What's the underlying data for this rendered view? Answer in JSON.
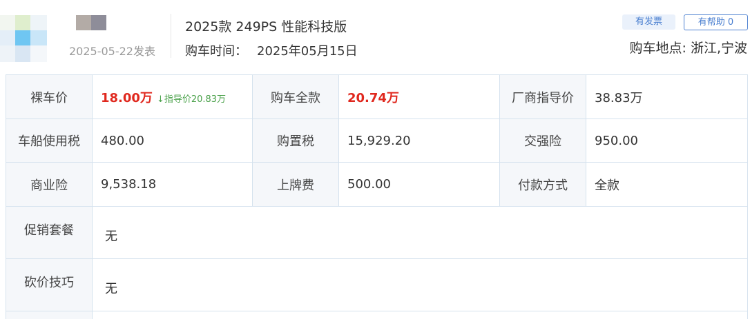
{
  "header": {
    "post_date": "2025-05-22发表",
    "car_model": "2025款 249PS 性能科技版",
    "purchase_time_label": "购车时间：",
    "purchase_time_value": "2025年05月15日",
    "invoice_tag": "有发票",
    "help_button": "有帮助 0",
    "location": "购车地点: 浙江,宁波"
  },
  "table": {
    "naked_price_label": "裸车价",
    "naked_price_value": "18.00万",
    "naked_price_note": "↓指导价20.83万",
    "total_price_label": "购车全款",
    "total_price_value": "20.74万",
    "msrp_label": "厂商指导价",
    "msrp_value": "38.83万",
    "vehicle_tax_label": "车船使用税",
    "vehicle_tax_value": "480.00",
    "purchase_tax_label": "购置税",
    "purchase_tax_value": "15,929.20",
    "compulsory_insurance_label": "交强险",
    "compulsory_insurance_value": "950.00",
    "commercial_insurance_label": "商业险",
    "commercial_insurance_value": "9,538.18",
    "plate_fee_label": "上牌费",
    "plate_fee_value": "500.00",
    "payment_method_label": "付款方式",
    "payment_method_value": "全款",
    "promotion_label": "促销套餐",
    "promotion_value": "无",
    "bargain_tips_label": "砍价技巧",
    "bargain_tips_value": "无"
  },
  "colors": {
    "accent_blue": "#4a7fd0",
    "price_red": "#e0281e",
    "note_green": "#4aa14a",
    "border": "#d5e2ee"
  }
}
